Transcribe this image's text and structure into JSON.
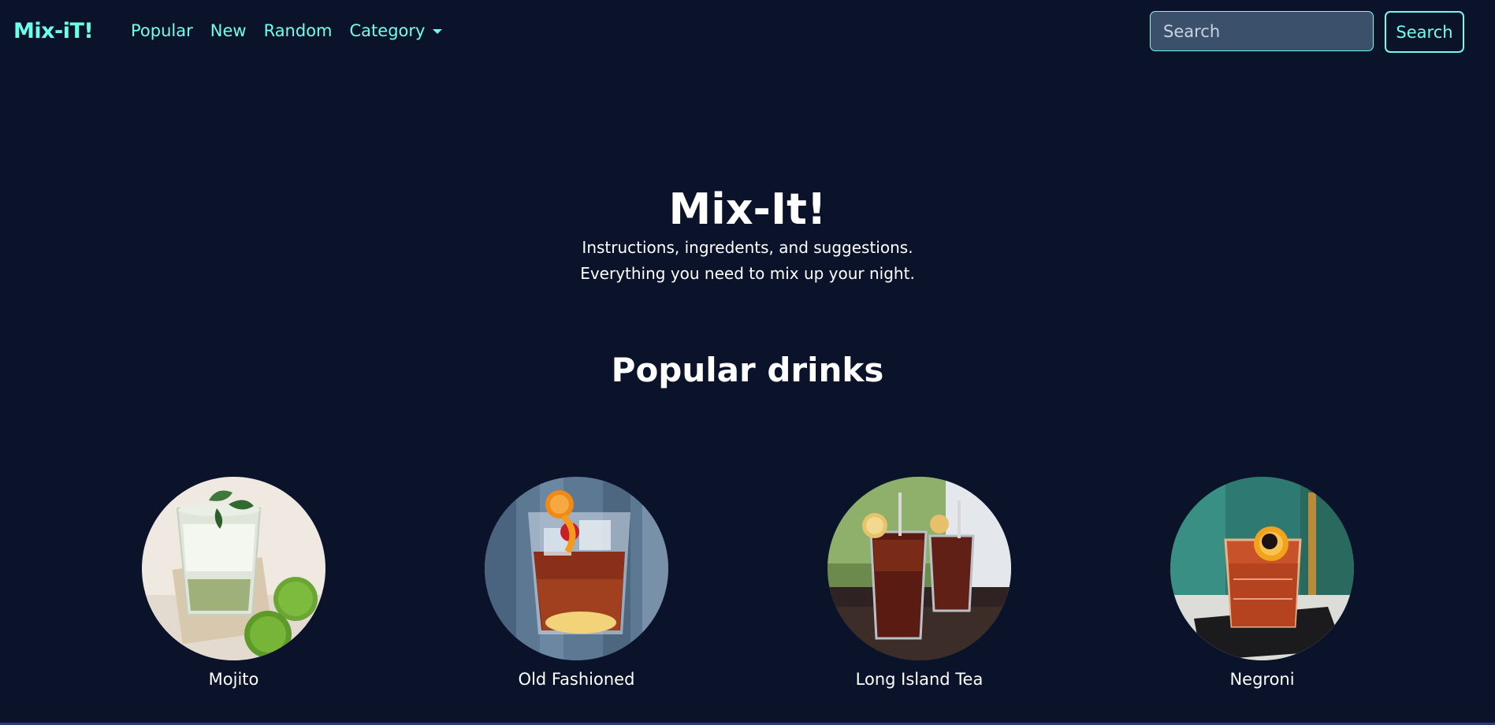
{
  "brand": "Mix-iT!",
  "nav": {
    "links": [
      "Popular",
      "New",
      "Random"
    ],
    "category_label": "Category"
  },
  "search": {
    "placeholder": "Search",
    "button_label": "Search"
  },
  "hero": {
    "title": "Mix-It!",
    "line1": "Instructions, ingredents, and suggestions.",
    "line2": "Everything you need to mix up your night."
  },
  "popular": {
    "title": "Popular drinks",
    "drinks": [
      {
        "name": "Mojito",
        "icon": "mojito-photo"
      },
      {
        "name": "Old Fashioned",
        "icon": "old-fashioned-photo"
      },
      {
        "name": "Long Island Tea",
        "icon": "long-island-tea-photo"
      },
      {
        "name": "Negroni",
        "icon": "negroni-photo"
      }
    ]
  },
  "colors": {
    "background": "#0b132b",
    "accent": "#6fffe9",
    "input_bg": "#3a506b"
  }
}
